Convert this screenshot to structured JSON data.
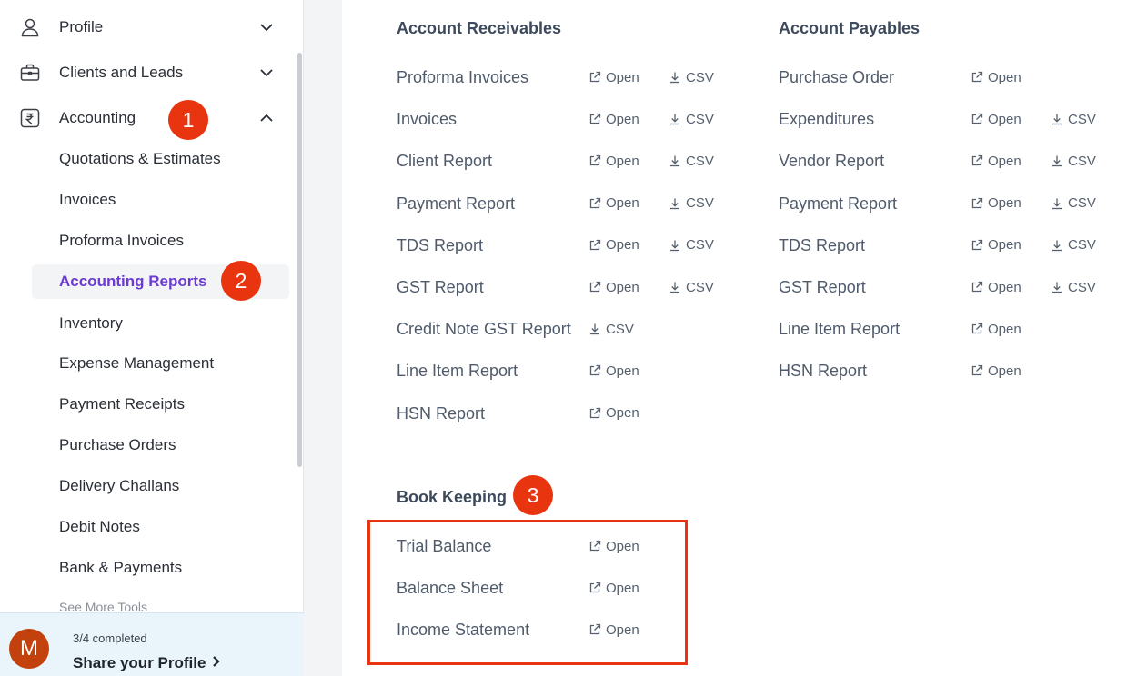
{
  "sidebar": {
    "nav": [
      {
        "label": "Profile",
        "icon": "user-icon",
        "expanded": false
      },
      {
        "label": "Clients and Leads",
        "icon": "briefcase-icon",
        "expanded": false
      },
      {
        "label": "Accounting",
        "icon": "rupee-icon",
        "expanded": true
      }
    ],
    "accounting_items": [
      "Quotations & Estimates",
      "Invoices",
      "Proforma Invoices",
      "Accounting Reports",
      "Inventory",
      "Expense Management",
      "Payment Receipts",
      "Purchase Orders",
      "Delivery Challans",
      "Debit Notes",
      "Bank & Payments"
    ],
    "active_item": "Accounting Reports",
    "see_more": "See More Tools",
    "profile_card": {
      "avatar_letter": "M",
      "progress_text": "3/4 completed",
      "share_label": "Share your Profile"
    }
  },
  "main": {
    "receivables": {
      "title": "Account Receivables",
      "items": [
        {
          "name": "Proforma Invoices",
          "open": "Open",
          "csv": "CSV"
        },
        {
          "name": "Invoices",
          "open": "Open",
          "csv": "CSV"
        },
        {
          "name": "Client Report",
          "open": "Open",
          "csv": "CSV"
        },
        {
          "name": "Payment Report",
          "open": "Open",
          "csv": "CSV"
        },
        {
          "name": "TDS Report",
          "open": "Open",
          "csv": "CSV"
        },
        {
          "name": "GST Report",
          "open": "Open",
          "csv": "CSV"
        },
        {
          "name": "Credit Note GST Report",
          "open": null,
          "csv": "CSV"
        },
        {
          "name": "Line Item Report",
          "open": "Open",
          "csv": null
        },
        {
          "name": "HSN Report",
          "open": "Open",
          "csv": null
        }
      ]
    },
    "payables": {
      "title": "Account Payables",
      "items": [
        {
          "name": "Purchase Order",
          "open": "Open",
          "csv": null
        },
        {
          "name": "Expenditures",
          "open": "Open",
          "csv": "CSV"
        },
        {
          "name": "Vendor Report",
          "open": "Open",
          "csv": "CSV"
        },
        {
          "name": "Payment Report",
          "open": "Open",
          "csv": "CSV"
        },
        {
          "name": "TDS Report",
          "open": "Open",
          "csv": "CSV"
        },
        {
          "name": "GST Report",
          "open": "Open",
          "csv": "CSV"
        },
        {
          "name": "Line Item Report",
          "open": "Open",
          "csv": null
        },
        {
          "name": "HSN Report",
          "open": "Open",
          "csv": null
        }
      ]
    },
    "bookkeeping": {
      "title": "Book Keeping",
      "items": [
        {
          "name": "Trial Balance",
          "open": "Open",
          "csv": null
        },
        {
          "name": "Balance Sheet",
          "open": "Open",
          "csv": null
        },
        {
          "name": "Income Statement",
          "open": "Open",
          "csv": null
        }
      ]
    }
  },
  "annotations": {
    "badges": [
      "1",
      "2",
      "3"
    ],
    "accent_color": "#e8340f"
  },
  "colors": {
    "active_text": "#6c3bd1",
    "avatar_bg": "#c2410c",
    "profile_card_bg": "#e9f4fb"
  }
}
